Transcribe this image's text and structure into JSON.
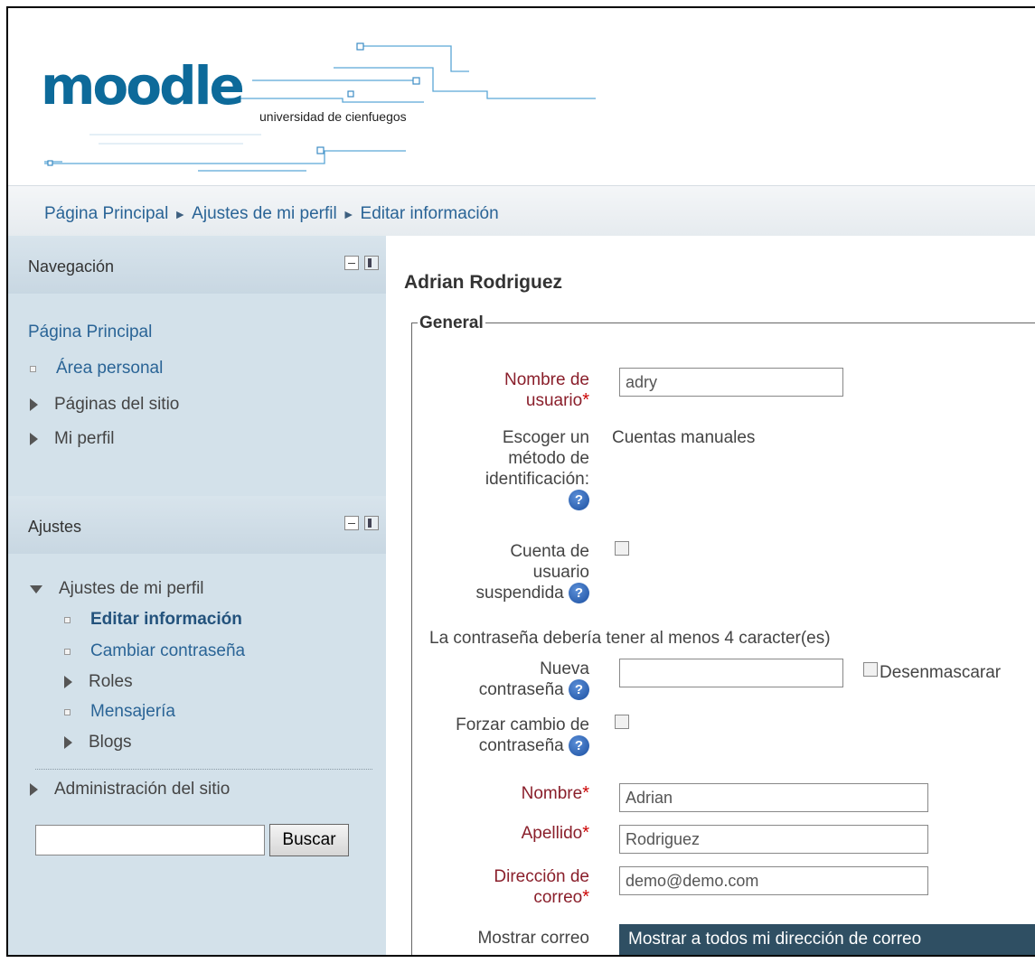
{
  "header": {
    "logo_text": "moodle",
    "logo_sub": "universidad de cienfuegos"
  },
  "breadcrumb": {
    "items": [
      "Página Principal",
      "Ajustes de mi perfil",
      "Editar información"
    ],
    "separator": "►"
  },
  "navigation": {
    "title": "Navegación",
    "home": "Página Principal",
    "items": [
      {
        "label": "Área personal",
        "icon": "bullet-square-icon"
      },
      {
        "label": "Páginas del sitio",
        "icon": "expand-triangle-icon"
      },
      {
        "label": "Mi perfil",
        "icon": "expand-triangle-icon"
      }
    ]
  },
  "settings": {
    "title": "Ajustes",
    "profile_settings": "Ajustes de mi perfil",
    "items": [
      {
        "label": "Editar información"
      },
      {
        "label": "Cambiar contraseña"
      },
      {
        "label": "Roles"
      },
      {
        "label": "Mensajería"
      },
      {
        "label": "Blogs"
      }
    ],
    "site_admin": "Administración del sitio",
    "search_value": "",
    "search_button": "Buscar"
  },
  "main": {
    "user_fullname": "Adrian Rodriguez",
    "legend": "General",
    "username_label_1": "Nombre de",
    "username_label_2": "usuario",
    "username_value": "adry",
    "auth_label_1": "Escoger un",
    "auth_label_2": "método de",
    "auth_label_3": "identificación:",
    "auth_value": "Cuentas manuales",
    "suspended_label_1": "Cuenta de",
    "suspended_label_2": "usuario",
    "suspended_label_3": "suspendida",
    "password_hint": "La contraseña debería tener al menos 4 caracter(es)",
    "newpass_label_1": "Nueva",
    "newpass_label_2": "contraseña",
    "newpass_value": "",
    "unmask_label": "Desenmascarar",
    "force_label_1": "Forzar cambio de",
    "force_label_2": "contraseña",
    "firstname_label": "Nombre",
    "firstname_value": "Adrian",
    "lastname_label": "Apellido",
    "lastname_value": "Rodriguez",
    "email_label_1": "Dirección de",
    "email_label_2": "correo",
    "email_value": "demo@demo.com",
    "maildisplay_label": "Mostrar correo",
    "maildisplay_value": "Mostrar a todos mi dirección de correo",
    "required_mark": "*",
    "help_glyph": "?"
  },
  "colors": {
    "sidebar_bg": "#d3e1ea",
    "link": "#2a6496",
    "required_label": "#8a1f2b",
    "select_bg": "#2f4f63"
  }
}
